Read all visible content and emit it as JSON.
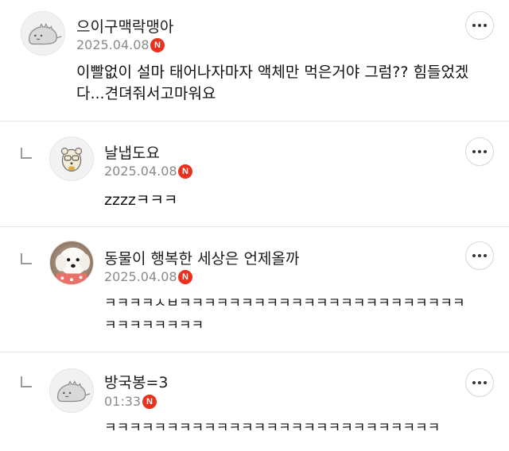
{
  "comments": [
    {
      "nickname": "으이구맥락맹아",
      "date": "2025.04.08",
      "badge": "N",
      "avatar": "dino-avatar-icon",
      "text_lines": [
        "이빨없이 설마 태어나자마자 액체만 먹은거야 그럼?? 힘들었겠",
        "다...견뎌줘서고마워요"
      ],
      "is_reply": false
    },
    {
      "nickname": "날냅도요",
      "date": "2025.04.08",
      "badge": "N",
      "avatar": "bear-character-avatar-icon",
      "text_lines": [
        "zzzzㅋㅋㅋ"
      ],
      "is_reply": true
    },
    {
      "nickname": "동물이 행복한 세상은 언제올까",
      "date": "2025.04.08",
      "badge": "N",
      "avatar": "white-dog-photo-avatar",
      "text_lines": [
        "ㅋㅋㅋㅋㅅㅂㅋㅋㅋㅋㅋㅋㅋㅋㅋㅋㅋㅋㅋㅋㅋㅋㅋㅋㅋㅋㅋㅋㅋ",
        "ㅋㅋㅋㅋㅋㅋㅋㅋ"
      ],
      "is_reply": true
    },
    {
      "nickname": "방국봉=3",
      "date": "01:33",
      "badge": "N",
      "avatar": "dino-avatar-icon",
      "text_lines": [
        "ㅋㅋㅋㅋㅋㅋㅋㅋㅋㅋㅋㅋㅋㅋㅋㅋㅋㅋㅋㅋㅋㅋㅋㅋㅋㅋㅋ"
      ],
      "is_reply": true
    }
  ],
  "colors": {
    "badge": "#e8311f",
    "date": "#8a8a8a",
    "divider": "#e6e6e6"
  },
  "icons": {
    "more": "more-options-icon",
    "reply": "reply-indent-icon"
  }
}
